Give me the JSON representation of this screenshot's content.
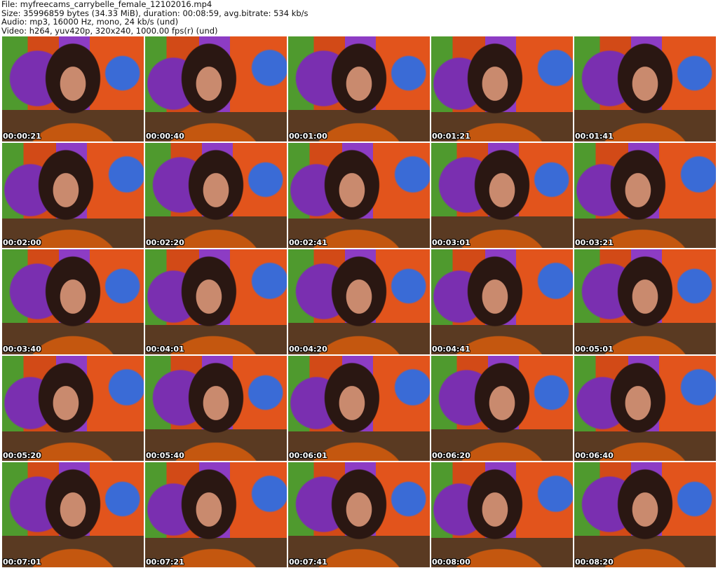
{
  "header": {
    "file": "File: myfreecams_carrybelle_female_12102016.mp4",
    "size": "Size: 35996859 bytes (34.33 MiB), duration: 00:08:59, avg.bitrate: 534 kb/s",
    "audio": "Audio: mp3, 16000 Hz, mono, 24 kb/s (und)",
    "video": "Video: h264, yuv420p, 320x240, 1000.00 fps(r) (und)"
  },
  "thumbnails": [
    "00:00:21",
    "00:00:40",
    "00:01:00",
    "00:01:21",
    "00:01:41",
    "00:02:00",
    "00:02:20",
    "00:02:41",
    "00:03:01",
    "00:03:21",
    "00:03:40",
    "00:04:01",
    "00:04:20",
    "00:04:41",
    "00:05:01",
    "00:05:20",
    "00:05:40",
    "00:06:01",
    "00:06:20",
    "00:06:40",
    "00:07:01",
    "00:07:21",
    "00:07:41",
    "00:08:00",
    "00:08:20"
  ]
}
